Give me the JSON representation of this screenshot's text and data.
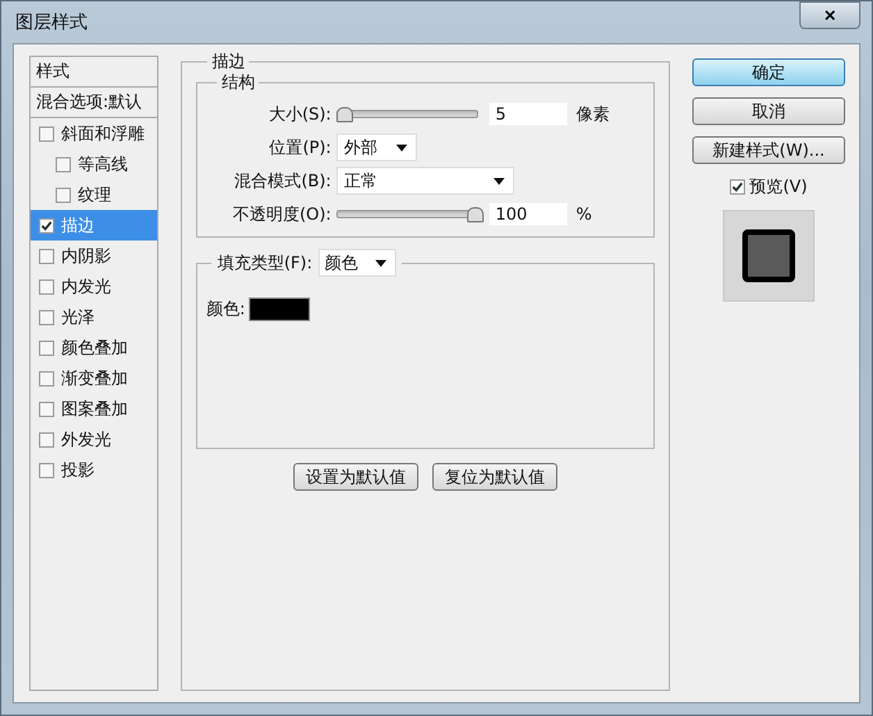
{
  "window": {
    "title": "图层样式",
    "close": "✕"
  },
  "sidebar": {
    "items": [
      {
        "kind": "header",
        "label": "样式"
      },
      {
        "kind": "plain",
        "label": "混合选项:默认",
        "selected": false
      },
      {
        "kind": "check",
        "label": "斜面和浮雕",
        "checked": false,
        "selected": false,
        "children": [
          {
            "kind": "check",
            "label": "等高线",
            "checked": false,
            "selected": false
          },
          {
            "kind": "check",
            "label": "纹理",
            "checked": false,
            "selected": false
          }
        ]
      },
      {
        "kind": "check",
        "label": "描边",
        "checked": true,
        "selected": true
      },
      {
        "kind": "check",
        "label": "内阴影",
        "checked": false,
        "selected": false
      },
      {
        "kind": "check",
        "label": "内发光",
        "checked": false,
        "selected": false
      },
      {
        "kind": "check",
        "label": "光泽",
        "checked": false,
        "selected": false
      },
      {
        "kind": "check",
        "label": "颜色叠加",
        "checked": false,
        "selected": false
      },
      {
        "kind": "check",
        "label": "渐变叠加",
        "checked": false,
        "selected": false
      },
      {
        "kind": "check",
        "label": "图案叠加",
        "checked": false,
        "selected": false
      },
      {
        "kind": "check",
        "label": "外发光",
        "checked": false,
        "selected": false
      },
      {
        "kind": "check",
        "label": "投影",
        "checked": false,
        "selected": false
      }
    ]
  },
  "panel": {
    "title": "描边",
    "structure": {
      "title": "结构",
      "rows": [
        {
          "kind": "slider",
          "label": "大小(S):",
          "level": 0.02,
          "value": "5",
          "unit": "像素"
        },
        {
          "kind": "select",
          "label": "位置(P):",
          "value": "外部",
          "wide": false
        },
        {
          "kind": "select",
          "label": "混合模式(B):",
          "value": "正常",
          "wide": true
        },
        {
          "kind": "slider",
          "label": "不透明度(O):",
          "level": 1,
          "value": "100",
          "unit": "%"
        }
      ]
    },
    "fill": {
      "label": "填充类型(F):",
      "value": "颜色",
      "color_label": "颜色:",
      "color": "#000000"
    },
    "buttons": [
      "设置为默认值",
      "复位为默认值"
    ]
  },
  "actions": [
    {
      "label": "确定",
      "default": true
    },
    {
      "label": "取消",
      "default": false
    },
    {
      "label": "新建样式(W)...",
      "default": false
    }
  ],
  "preview": {
    "label": "预览(V)",
    "checked": true
  }
}
